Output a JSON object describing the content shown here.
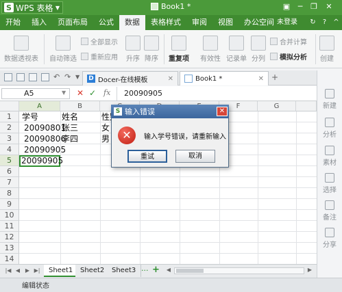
{
  "app": {
    "name": "WPS 表格",
    "document_title": "Book1 *"
  },
  "menu": {
    "items": [
      "开始",
      "插入",
      "页面布局",
      "公式",
      "数据",
      "表格样式",
      "审阅",
      "视图",
      "办公空间"
    ],
    "active_index": 4,
    "login": "未登录"
  },
  "ribbon": {
    "pivot": "数据透视表",
    "autofilter": "自动筛选",
    "show_all": "全部显示",
    "reapply": "重新应用",
    "asc": "升序",
    "desc": "降序",
    "duplicates": "重复项",
    "validity": "有效性",
    "form": "记录单",
    "split": "分列",
    "merge_calc": "合并计算",
    "simulation": "模拟分析",
    "create": "创建"
  },
  "tabs": [
    {
      "label": "Docer-在线模板",
      "icon": "D"
    },
    {
      "label": "Book1 *",
      "icon": ""
    }
  ],
  "formula_bar": {
    "name_box": "A5",
    "fx": "fx",
    "value": "20090905"
  },
  "sheet": {
    "columns": [
      "A",
      "B",
      "C",
      "D",
      "E",
      "F",
      "G"
    ],
    "rows": [
      "1",
      "2",
      "3",
      "4",
      "5",
      "6",
      "7",
      "8",
      "9",
      "10",
      "11",
      "12",
      "13",
      "14"
    ],
    "cells": {
      "a1": "学号",
      "b1": "姓名",
      "c1": "性别",
      "a2": "20090801",
      "b2": "张三",
      "c2": "女",
      "a3": "20090806",
      "b3": "李四",
      "c3": "男",
      "a4": "20090905",
      "a5": "20090905"
    },
    "tabs": [
      "Sheet1",
      "Sheet2",
      "Sheet3"
    ],
    "more": "···",
    "add": "+"
  },
  "status": {
    "text": "编辑状态"
  },
  "right_panel": [
    "新建",
    "分析",
    "素材",
    "选择",
    "备注",
    "分享"
  ],
  "dialog": {
    "title": "输入错误",
    "message": "输入学号错误，请重新输入",
    "retry": "重试",
    "cancel": "取消",
    "close": "✕"
  }
}
